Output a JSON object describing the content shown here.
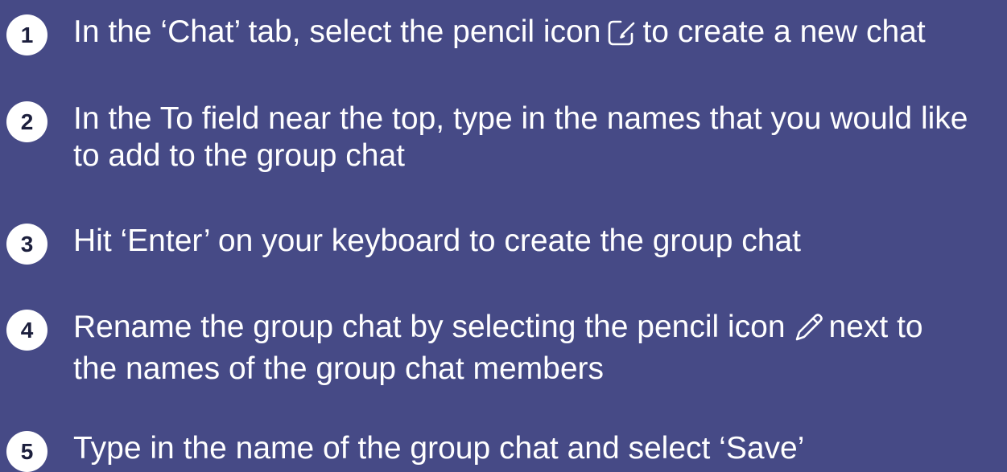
{
  "colors": {
    "background": "#464a86",
    "text": "#ffffff",
    "badge_bg": "#ffffff",
    "badge_text": "#1c1f3d"
  },
  "steps": [
    {
      "number": "1",
      "before_icon": "In the ‘Chat’ tab, select the pencil icon",
      "icon": "new-chat-icon",
      "after_icon": "to create a new chat"
    },
    {
      "number": "2",
      "line1": "In the To field near the top, type in the names that you would like",
      "line2": "to add to the group chat"
    },
    {
      "number": "3",
      "line1": "Hit ‘Enter’ on your keyboard to create the group chat"
    },
    {
      "number": "4",
      "before_icon": "Rename the group chat by selecting the pencil icon",
      "icon": "pencil-icon",
      "after_icon": "next to",
      "line2": "the names of the group chat members"
    },
    {
      "number": "5",
      "line1": "Type in the name of the group chat and select ‘Save’"
    }
  ]
}
